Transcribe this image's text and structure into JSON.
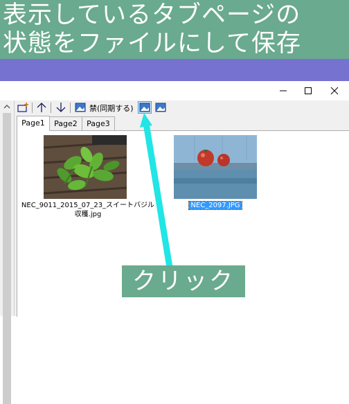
{
  "banner": {
    "line1": "表示しているタブページの",
    "line2": "状態をファイルにして保存"
  },
  "toolbar": {
    "sync_label": "禁(同期する)",
    "icons": [
      "add-tab-icon",
      "move-up-icon",
      "move-down-icon",
      "image-sync-icon",
      "save-image-icon",
      "image-icon"
    ]
  },
  "tabs": [
    {
      "label": "Page1",
      "active": true
    },
    {
      "label": "Page2",
      "active": false
    },
    {
      "label": "Page3",
      "active": false
    }
  ],
  "files": [
    {
      "name_line1": "NEC_9011_2015_07_23_スイートバジル",
      "name_line2": "収穫.jpg",
      "selected": false
    },
    {
      "name_line1": "NEC_2097.JPG",
      "name_line2": "",
      "selected": true
    }
  ],
  "annotation": {
    "label": "クリック",
    "color": "#6aaa8e",
    "arrow_color": "#22e5e5"
  }
}
